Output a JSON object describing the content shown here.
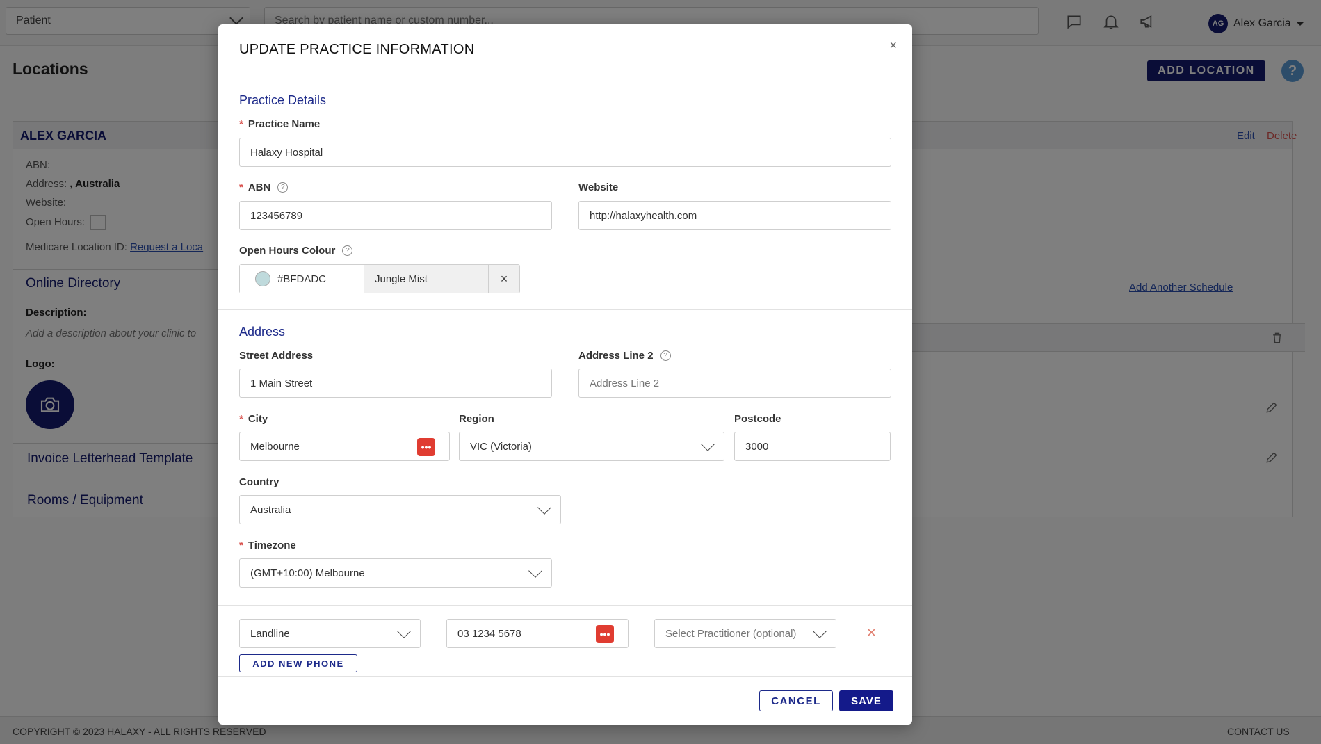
{
  "topbar": {
    "patient_select": "Patient",
    "search_placeholder": "Search by patient name or custom number...",
    "user_initials": "AG",
    "user_name": "Alex Garcia"
  },
  "page": {
    "title": "Locations",
    "add_location": "ADD LOCATION",
    "help": "?"
  },
  "location": {
    "name": "ALEX GARCIA",
    "edit": "Edit",
    "delete": "Delete",
    "abn_label": "ABN:",
    "address_label": "Address:",
    "address_value": ", Australia",
    "website_label": "Website:",
    "open_hours_label": "Open Hours:",
    "medicare_label": "Medicare Location ID:",
    "medicare_link": "Request a Loca",
    "online_directory": "Online Directory",
    "description_label": "Description:",
    "description_placeholder": "Add a description about your clinic to",
    "logo_label": "Logo:",
    "invoice_section": "Invoice Letterhead Template",
    "rooms_section": "Rooms / Equipment",
    "add_schedule": "Add Another Schedule"
  },
  "footer": {
    "copyright": "COPYRIGHT © 2023 HALAXY - ALL RIGHTS RESERVED",
    "contact": "CONTACT US"
  },
  "modal": {
    "title": "UPDATE PRACTICE INFORMATION",
    "close": "×",
    "practice_details": "Practice Details",
    "practice_name_label": "Practice Name",
    "practice_name_value": "Halaxy Hospital",
    "abn_label": "ABN",
    "abn_value": "123456789",
    "website_label": "Website",
    "website_value": "http://halaxyhealth.com",
    "open_hours_colour_label": "Open Hours Colour",
    "colour_hex": "#BFDADC",
    "colour_name": "Jungle Mist",
    "address_section": "Address",
    "street_label": "Street Address",
    "street_value": "1 Main Street",
    "address2_label": "Address Line 2",
    "address2_placeholder": "Address Line 2",
    "city_label": "City",
    "city_value": "Melbourne",
    "region_label": "Region",
    "region_value": "VIC (Victoria)",
    "postcode_label": "Postcode",
    "postcode_value": "3000",
    "country_label": "Country",
    "country_value": "Australia",
    "timezone_label": "Timezone",
    "timezone_value": "(GMT+10:00) Melbourne",
    "phone_type": "Landline",
    "phone_number": "03 1234 5678",
    "practitioner_placeholder": "Select Practitioner (optional)",
    "add_phone": "ADD NEW PHONE",
    "cancel": "CANCEL",
    "save": "SAVE",
    "required_marker": "*",
    "pw_dots": "•••",
    "remove_phone": "×",
    "clear_colour": "×"
  },
  "colors": {
    "brand_navy": "#141a6e",
    "swatch": "#BFDADC",
    "danger": "#d9534f",
    "password_badge": "#e03c31"
  },
  "icons": {
    "chat": "chat-bubble-icon",
    "bell": "bell-icon",
    "megaphone": "megaphone-icon",
    "camera": "camera-icon",
    "trash": "trash-icon",
    "pencil": "pencil-icon",
    "help": "question-circle-icon"
  }
}
